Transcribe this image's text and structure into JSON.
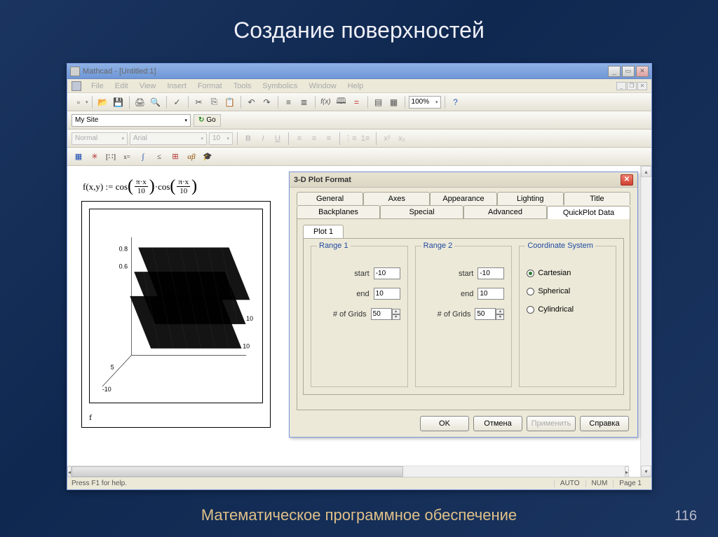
{
  "slide": {
    "title": "Создание поверхностей",
    "footer": "Математическое программное обеспечение",
    "number": "116"
  },
  "app": {
    "title": "Mathcad - [Untitled:1]",
    "menus": [
      "File",
      "Edit",
      "View",
      "Insert",
      "Format",
      "Tools",
      "Symbolics",
      "Window",
      "Help"
    ],
    "site": "My Site",
    "go": "Go",
    "style": "Normal",
    "font": "Arial",
    "size": "10",
    "zoom": "100%",
    "status": {
      "help": "Press F1 for help.",
      "auto": "AUTO",
      "num": "NUM",
      "page": "Page 1"
    }
  },
  "formula": {
    "lhs": "f(x,y) :=",
    "fn1": "cos",
    "num1": "π·x",
    "den1": "10",
    "fn2": "·cos",
    "num2": "π·x",
    "den2": "10"
  },
  "plot": {
    "ticks": [
      "0.8",
      "0.6",
      "5",
      "-10",
      "10",
      "10"
    ],
    "label": "f"
  },
  "dialog": {
    "title": "3-D Plot Format",
    "tabs_top": [
      "General",
      "Axes",
      "Appearance",
      "Lighting",
      "Title"
    ],
    "tabs_bot": [
      "Backplanes",
      "Special",
      "Advanced",
      "QuickPlot Data"
    ],
    "subtab": "Plot 1",
    "range1": {
      "legend": "Range 1",
      "start_lbl": "start",
      "start": "-10",
      "end_lbl": "end",
      "end": "10",
      "grids_lbl": "# of Grids",
      "grids": "50"
    },
    "range2": {
      "legend": "Range 2",
      "start_lbl": "start",
      "start": "-10",
      "end_lbl": "end",
      "end": "10",
      "grids_lbl": "# of Grids",
      "grids": "50"
    },
    "coord": {
      "legend": "Coordinate System",
      "opt1": "Cartesian",
      "opt2": "Spherical",
      "opt3": "Cylindrical"
    },
    "buttons": {
      "ok": "OK",
      "cancel": "Отмена",
      "apply": "Применить",
      "help": "Справка"
    }
  }
}
